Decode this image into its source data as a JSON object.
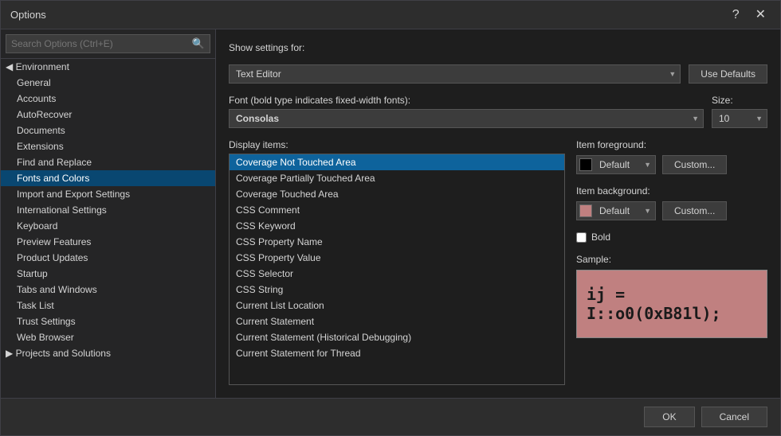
{
  "dialog": {
    "title": "Options",
    "help_btn": "?",
    "close_btn": "✕"
  },
  "sidebar": {
    "search_placeholder": "Search Options (Ctrl+E)",
    "items": [
      {
        "id": "environment",
        "label": "◀ Environment",
        "level": "category",
        "expanded": true
      },
      {
        "id": "general",
        "label": "General",
        "level": "sub"
      },
      {
        "id": "accounts",
        "label": "Accounts",
        "level": "sub"
      },
      {
        "id": "autorecover",
        "label": "AutoRecover",
        "level": "sub"
      },
      {
        "id": "documents",
        "label": "Documents",
        "level": "sub"
      },
      {
        "id": "extensions",
        "label": "Extensions",
        "level": "sub"
      },
      {
        "id": "find-replace",
        "label": "Find and Replace",
        "level": "sub"
      },
      {
        "id": "fonts-colors",
        "label": "Fonts and Colors",
        "level": "sub",
        "selected": true
      },
      {
        "id": "import-export",
        "label": "Import and Export Settings",
        "level": "sub"
      },
      {
        "id": "international",
        "label": "International Settings",
        "level": "sub"
      },
      {
        "id": "keyboard",
        "label": "Keyboard",
        "level": "sub"
      },
      {
        "id": "preview-features",
        "label": "Preview Features",
        "level": "sub"
      },
      {
        "id": "product-updates",
        "label": "Product Updates",
        "level": "sub"
      },
      {
        "id": "startup",
        "label": "Startup",
        "level": "sub"
      },
      {
        "id": "tabs-windows",
        "label": "Tabs and Windows",
        "level": "sub"
      },
      {
        "id": "task-list",
        "label": "Task List",
        "level": "sub"
      },
      {
        "id": "trust-settings",
        "label": "Trust Settings",
        "level": "sub"
      },
      {
        "id": "web-browser",
        "label": "Web Browser",
        "level": "sub"
      },
      {
        "id": "projects-solutions",
        "label": "▶ Projects and Solutions",
        "level": "category"
      }
    ]
  },
  "main": {
    "show_settings_label": "Show settings for:",
    "show_settings_value": "Text Editor",
    "use_defaults_btn": "Use Defaults",
    "font_label": "Font (bold type indicates fixed-width fonts):",
    "font_value": "Consolas",
    "size_label": "Size:",
    "size_value": "10",
    "display_items_label": "Display items:",
    "display_items": [
      "Coverage Not Touched Area",
      "Coverage Partially Touched Area",
      "Coverage Touched Area",
      "CSS Comment",
      "CSS Keyword",
      "CSS Property Name",
      "CSS Property Value",
      "CSS Selector",
      "CSS String",
      "Current List Location",
      "Current Statement",
      "Current Statement (Historical Debugging)",
      "Current Statement for Thread"
    ],
    "selected_display_item": "Coverage Not Touched Area",
    "item_foreground_label": "Item foreground:",
    "item_foreground_value": "Default",
    "item_foreground_color": "#000000",
    "fg_custom_btn": "Custom...",
    "item_background_label": "Item background:",
    "item_background_value": "Default",
    "item_background_color": "#c08080",
    "bg_custom_btn": "Custom...",
    "bold_label": "Bold",
    "bold_checked": false,
    "sample_label": "Sample:",
    "sample_code": "ij = I::o0(0xB81l);"
  },
  "footer": {
    "ok_btn": "OK",
    "cancel_btn": "Cancel"
  }
}
